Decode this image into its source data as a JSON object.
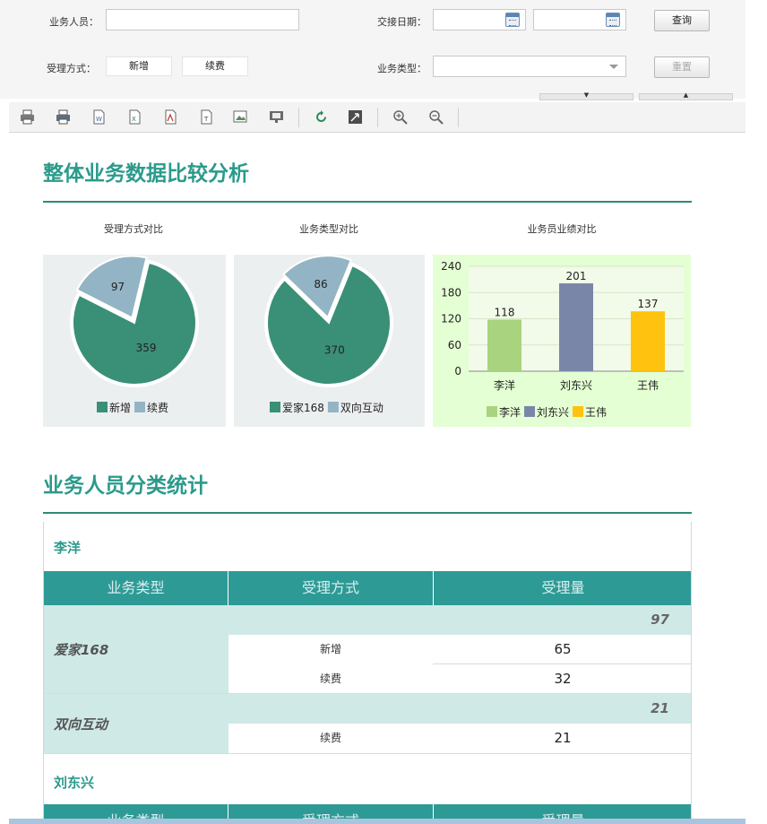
{
  "query": {
    "staff_label": "业务人员：",
    "staff_value": "",
    "date_label": "交接日期：",
    "date_from": "",
    "date_to": "",
    "search_label": "查询",
    "method_label": "受理方式：",
    "method_option_new": "新增",
    "method_option_renew": "续费",
    "type_label": "业务类型：",
    "type_value": "",
    "reset_label": "重置",
    "collapse_down": "▼",
    "collapse_up": "▲"
  },
  "toolbar": {
    "icons": [
      "print-icon",
      "print-preview-icon",
      "export-word-icon",
      "export-excel-icon",
      "export-pdf-icon",
      "export-text-icon",
      "export-image-icon",
      "export-ppt-icon",
      "refresh-icon",
      "fullscreen-icon",
      "zoom-in-icon",
      "zoom-out-icon"
    ]
  },
  "overview": {
    "title": "整体业务数据比较分析"
  },
  "chart_data": [
    {
      "type": "pie",
      "title": "受理方式对比",
      "labels": [
        "新增",
        "续费"
      ],
      "values": [
        359,
        97
      ],
      "colors": [
        "#3a8f77",
        "#93b4c5"
      ]
    },
    {
      "type": "pie",
      "title": "业务类型对比",
      "labels": [
        "爱家168",
        "双向互动"
      ],
      "values": [
        370,
        86
      ],
      "colors": [
        "#3a8f77",
        "#93b4c5"
      ]
    },
    {
      "type": "bar",
      "title": "业务员业绩对比",
      "categories": [
        "李洋",
        "刘东兴",
        "王伟"
      ],
      "values": [
        118,
        201,
        137
      ],
      "colors": [
        "#a9d37f",
        "#7a86a8",
        "#ffc20e"
      ],
      "yticks": [
        0,
        60,
        120,
        180,
        240
      ],
      "ylim": [
        0,
        240
      ],
      "legend": [
        "李洋",
        "刘东兴",
        "王伟"
      ]
    }
  ],
  "staff_stats": {
    "title": "业务人员分类统计",
    "headers": [
      "业务类型",
      "受理方式",
      "受理量"
    ],
    "persons": [
      {
        "name": "李洋",
        "groups": [
          {
            "type": "爱家168",
            "subtotal": "97",
            "rows": [
              {
                "method": "新增",
                "qty": "65"
              },
              {
                "method": "续费",
                "qty": "32"
              }
            ]
          },
          {
            "type": "双向互动",
            "subtotal": "21",
            "rows": [
              {
                "method": "续费",
                "qty": "21"
              }
            ]
          }
        ]
      },
      {
        "name": "刘东兴",
        "groups": []
      }
    ]
  }
}
